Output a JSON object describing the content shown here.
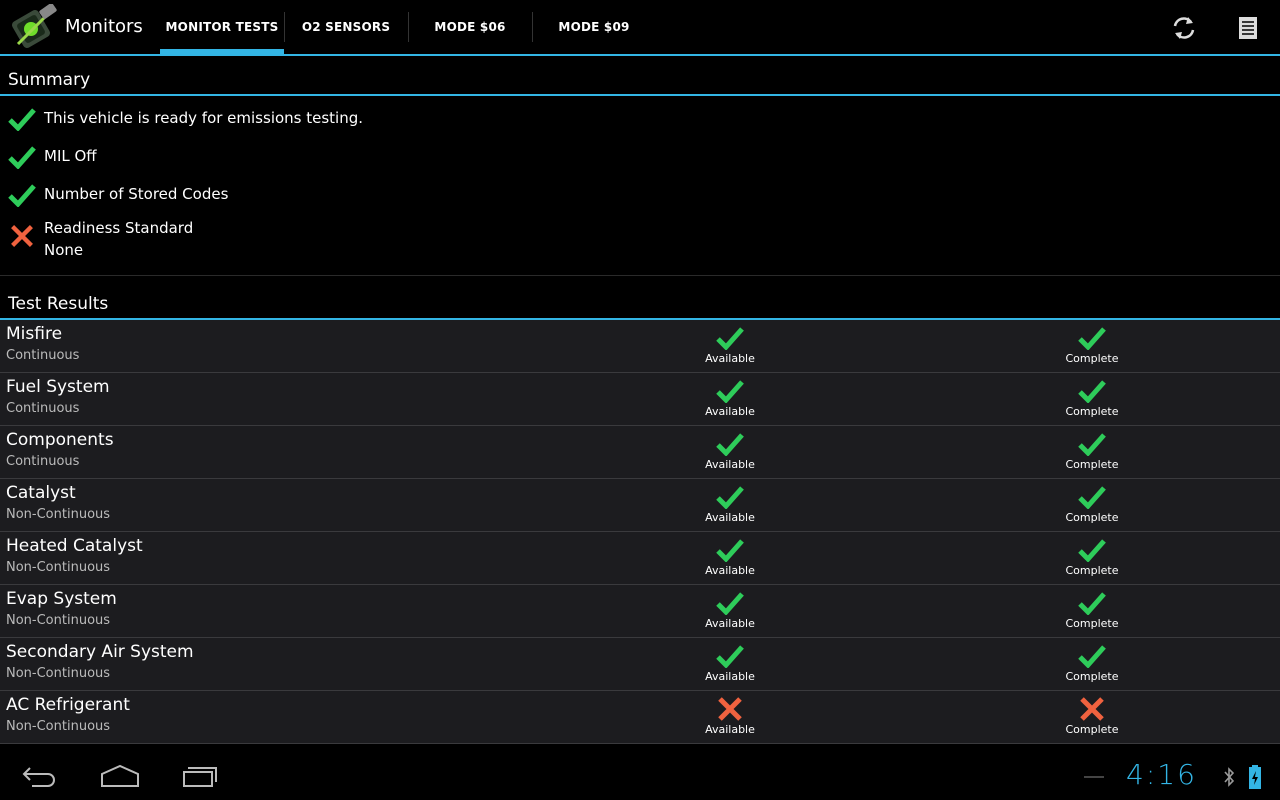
{
  "app": {
    "title": "Monitors"
  },
  "tabs": [
    {
      "label": "MONITOR TESTS",
      "active": true
    },
    {
      "label": "O2 SENSORS",
      "active": false
    },
    {
      "label": "MODE $06",
      "active": false
    },
    {
      "label": "MODE $09",
      "active": false
    }
  ],
  "actions": {
    "refresh_icon": "refresh-icon",
    "log_icon": "document-icon"
  },
  "summary": {
    "header": "Summary",
    "items": [
      {
        "status": "pass",
        "text": "This vehicle is ready for emissions testing."
      },
      {
        "status": "pass",
        "text": "MIL Off"
      },
      {
        "status": "pass",
        "text": "Number of Stored Codes"
      },
      {
        "status": "fail",
        "text": "Readiness Standard",
        "sub": "None"
      }
    ]
  },
  "results": {
    "header": "Test Results",
    "rows": [
      {
        "name": "Misfire",
        "type": "Continuous",
        "available": {
          "ok": true,
          "label": "Available"
        },
        "complete": {
          "ok": true,
          "label": "Complete"
        }
      },
      {
        "name": "Fuel System",
        "type": "Continuous",
        "available": {
          "ok": true,
          "label": "Available"
        },
        "complete": {
          "ok": true,
          "label": "Complete"
        }
      },
      {
        "name": "Components",
        "type": "Continuous",
        "available": {
          "ok": true,
          "label": "Available"
        },
        "complete": {
          "ok": true,
          "label": "Complete"
        }
      },
      {
        "name": "Catalyst",
        "type": "Non-Continuous",
        "available": {
          "ok": true,
          "label": "Available"
        },
        "complete": {
          "ok": true,
          "label": "Complete"
        }
      },
      {
        "name": "Heated Catalyst",
        "type": "Non-Continuous",
        "available": {
          "ok": true,
          "label": "Available"
        },
        "complete": {
          "ok": true,
          "label": "Complete"
        }
      },
      {
        "name": "Evap System",
        "type": "Non-Continuous",
        "available": {
          "ok": true,
          "label": "Available"
        },
        "complete": {
          "ok": true,
          "label": "Complete"
        }
      },
      {
        "name": "Secondary Air System",
        "type": "Non-Continuous",
        "available": {
          "ok": true,
          "label": "Available"
        },
        "complete": {
          "ok": true,
          "label": "Complete"
        }
      },
      {
        "name": "AC Refrigerant",
        "type": "Non-Continuous",
        "available": {
          "ok": false,
          "label": "Available"
        },
        "complete": {
          "ok": false,
          "label": "Complete"
        }
      }
    ]
  },
  "status_bar": {
    "time": "4:16"
  },
  "colors": {
    "accent": "#33b5e5",
    "pass": "#2ecc5a",
    "fail": "#f0623f"
  }
}
